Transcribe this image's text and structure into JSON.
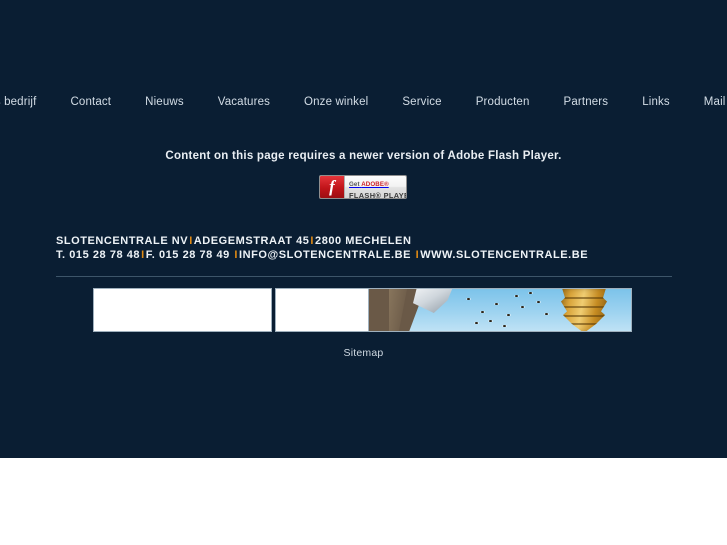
{
  "page": {
    "background_color": "#0a1e33",
    "bottom_background_color": "#ffffff",
    "accent_color": "#e08a14",
    "text_color": "#eef3f7"
  },
  "nav": {
    "items": [
      {
        "label": "Ons bedrijf"
      },
      {
        "label": "Contact"
      },
      {
        "label": "Nieuws"
      },
      {
        "label": "Vacatures"
      },
      {
        "label": "Onze winkel"
      },
      {
        "label": "Service"
      },
      {
        "label": "Producten"
      },
      {
        "label": "Partners"
      },
      {
        "label": "Links"
      },
      {
        "label": "Mail ons"
      }
    ]
  },
  "flash": {
    "notice": "Content on this page requires a newer version of Adobe Flash Player.",
    "badge": {
      "get_label": "Get",
      "adobe_label": "ADOBE®",
      "product_label": "FLASH® PLAYER",
      "icon": "flash-f-icon",
      "download_icon": "download-arrow-icon"
    }
  },
  "address": {
    "line1": {
      "company": "SLOTENCENTRALE NV",
      "street": "ADEGEMSTRAAT 45",
      "city": "2800 MECHELEN",
      "separator": "I"
    },
    "line2": {
      "tel": "T. 015 28 78 48",
      "fax": "F. 015 28 78 49",
      "email": "INFO@SLOTENCENTRALE.BE",
      "website": "WWW.SLOTENCENTRALE.BE",
      "separator": "I"
    }
  },
  "strip": {
    "panels": [
      {
        "name": "empty-panel-1",
        "type": "blank"
      },
      {
        "name": "empty-panel-2",
        "type": "blank"
      },
      {
        "name": "photo-panel",
        "type": "photo",
        "description": "tree trunk with bees and a golden beehive against a blue sky"
      }
    ]
  },
  "footer": {
    "sitemap_label": "Sitemap"
  }
}
